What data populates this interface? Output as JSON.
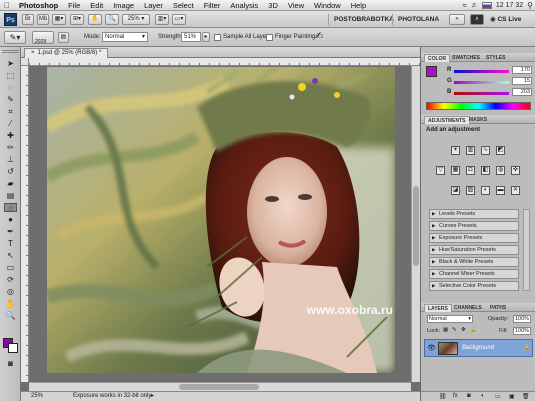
{
  "menubar": {
    "apple": "",
    "app": "Photoshop",
    "items": [
      "File",
      "Edit",
      "Image",
      "Layer",
      "Select",
      "Filter",
      "Analysis",
      "3D",
      "View",
      "Window",
      "Help"
    ],
    "clock": "12 17 32",
    "wifi_icon": "wifi-icon",
    "volume_icon": "speaker-icon"
  },
  "appbar": {
    "logo": "Ps",
    "zoom": "25%",
    "workspaces": [
      "POSTOBRABOTKA",
      "PHOTOLANA"
    ],
    "cs_live": "CS Live"
  },
  "options": {
    "brush_size": "2028",
    "mode_label": "Mode:",
    "mode_value": "Normal",
    "strength_label": "Strength:",
    "strength_value": "51%",
    "sample_all_layers": "Sample All Layers",
    "finger_painting": "Finger Painting"
  },
  "document": {
    "tab_title": "1.psd @ 25% (RGB/8) *",
    "zoom": "25%",
    "status_text": "Exposure works in 32-bit only"
  },
  "color_panel": {
    "tabs": [
      "COLOR",
      "SWATCHES",
      "STYLES"
    ],
    "r": "170",
    "g": "15",
    "b": "203",
    "fg_color": "#aa0fcb"
  },
  "adjustments_panel": {
    "tabs": [
      "ADJUSTMENTS",
      "MASKS"
    ],
    "heading": "Add an adjustment",
    "presets": [
      "Levels Presets",
      "Curves Presets",
      "Exposure Presets",
      "Hue/Saturation Presets",
      "Black & White Presets",
      "Channel Mixer Presets",
      "Selective Color Presets"
    ]
  },
  "layers_panel": {
    "tabs": [
      "LAYERS",
      "CHANNELS",
      "PATHS"
    ],
    "blend_mode": "Normal",
    "opacity_label": "Opacity:",
    "opacity_value": "100%",
    "lock_label": "Lock:",
    "fill_label": "Fill:",
    "fill_value": "100%",
    "layers": [
      {
        "name": "Background",
        "locked": true,
        "visible": true
      }
    ]
  },
  "watermark": "www.oxobra.ru"
}
